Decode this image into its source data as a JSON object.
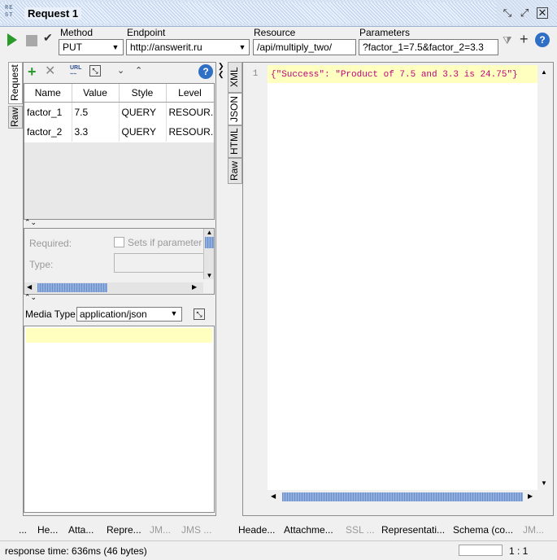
{
  "window": {
    "logo": "RE\nST",
    "title": "Request 1"
  },
  "toolbar": {
    "method_label": "Method",
    "method_value": "PUT",
    "endpoint_label": "Endpoint",
    "endpoint_value": "http://answerit.ru",
    "resource_label": "Resource",
    "resource_value": "/api/multiply_two/",
    "parameters_label": "Parameters",
    "parameters_value": "?factor_1=7.5&factor_2=3.3"
  },
  "left_tabs": [
    "Request",
    "Raw"
  ],
  "params_table": {
    "columns": [
      "Name",
      "Value",
      "Style",
      "Level"
    ],
    "rows": [
      {
        "name": "factor_1",
        "value": "7.5",
        "style": "QUERY",
        "level": "RESOUR..."
      },
      {
        "name": "factor_2",
        "value": "3.3",
        "style": "QUERY",
        "level": "RESOUR..."
      }
    ]
  },
  "param_details": {
    "required_label": "Required:",
    "sets_if_label": "Sets if parameter",
    "type_label": "Type:"
  },
  "media": {
    "label": "Media Type",
    "value": "application/json"
  },
  "response_tabs": [
    "XML",
    "JSON",
    "HTML",
    "Raw"
  ],
  "response": {
    "line_number": "1",
    "body": "{\"Success\": \"Product of 7.5 and 3.3 is 24.75\"}"
  },
  "left_bottom_tabs": [
    "...",
    "He...",
    "Atta...",
    "Repre...",
    "JM...",
    "JMS ..."
  ],
  "right_bottom_tabs": [
    "Heade...",
    "Attachme...",
    "SSL ...",
    "Representati...",
    "Schema (co...",
    "JM..."
  ],
  "status": {
    "text": "response time: 636ms (46 bytes)",
    "position": "1 : 1"
  },
  "colors": {
    "accent": "#2a8a2a",
    "json_text": "#c0007a",
    "highlight": "#ffffc0",
    "scroll": "#7a9bd1"
  }
}
